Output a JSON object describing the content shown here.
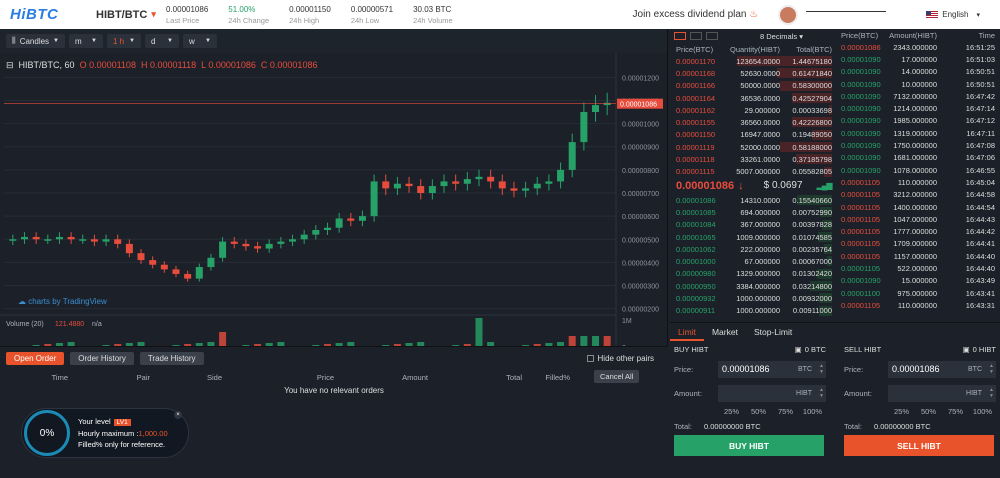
{
  "header": {
    "logo": "HiBTC",
    "pair": "HIBT/BTC",
    "stats": [
      {
        "value": "0.00001086",
        "label": "Last Price"
      },
      {
        "value": "51.00%",
        "label": "24h Change",
        "positive": true
      },
      {
        "value": "0.00001150",
        "label": "24h High"
      },
      {
        "value": "0.00000571",
        "label": "24h Low"
      },
      {
        "value": "30.03 BTC",
        "label": "24h Volume"
      }
    ],
    "promo": "Join excess dividend plan",
    "language": "English"
  },
  "chart_toolbar": {
    "candles": "Candles",
    "minute": "m",
    "hour": "1 h",
    "day": "d",
    "week": "w"
  },
  "chart_legend": {
    "symbol": "HIBT/BTC, 60",
    "o": "O 0.00001108",
    "h": "H 0.00001118",
    "l": "L 0.00001086",
    "c": "C 0.00001086"
  },
  "chart_data": {
    "type": "candlestick",
    "price_axis": [
      "0.00001200",
      "0.00001100",
      "0.00001000",
      "0.00000900",
      "0.00000800",
      "0.00000700",
      "0.00000600",
      "0.00000500",
      "0.00000400",
      "0.00000300",
      "0.00000200"
    ],
    "last_price_tag": "0.00001086",
    "x_ticks": [
      "Sep",
      "2",
      "3",
      "4",
      "5",
      "6",
      "10:00"
    ],
    "volume_label": "Volume (20)",
    "volume_value": "121.4880",
    "volume_na": "n/a",
    "volume_axis": "1M",
    "volume_zero": "0",
    "watermark": "charts by TradingView",
    "ylim": [
      1.9e-06,
      1.21e-05
    ],
    "closes": [
      5e-06,
      5.1e-06,
      5e-06,
      5e-06,
      5.1e-06,
      5e-06,
      5e-06,
      4.9e-06,
      5e-06,
      4.8e-06,
      4.4e-06,
      4.1e-06,
      3.9e-06,
      3.7e-06,
      3.5e-06,
      3.3e-06,
      3.8e-06,
      4.2e-06,
      4.9e-06,
      4.8e-06,
      4.7e-06,
      4.6e-06,
      4.8e-06,
      4.9e-06,
      5e-06,
      5.2e-06,
      5.4e-06,
      5.5e-06,
      5.9e-06,
      5.8e-06,
      6e-06,
      7.5e-06,
      7.2e-06,
      7.4e-06,
      7.3e-06,
      7e-06,
      7.3e-06,
      7.5e-06,
      7.4e-06,
      7.6e-06,
      7.7e-06,
      7.5e-06,
      7.2e-06,
      7.1e-06,
      7.2e-06,
      7.4e-06,
      7.5e-06,
      8e-06,
      9.2e-06,
      1.05e-05,
      1.08e-05,
      1.09e-05
    ]
  },
  "orders": {
    "tabs": [
      "Open Order",
      "Order History",
      "Trade History"
    ],
    "hide_other": "Hide other pairs",
    "columns": [
      "Time",
      "Pair",
      "Side",
      "Price",
      "Amount",
      "Total",
      "Filled%"
    ],
    "cancel_all": "Cancel All",
    "empty": "You have no relevant orders"
  },
  "level": {
    "percent": "0%",
    "your_level": "Your level",
    "badge": "LV1",
    "hourly_label": "Hourly maximum :",
    "hourly_value": "1,000.00",
    "note": "Filled% only for reference."
  },
  "orderbook": {
    "decimals": "8 Decimals",
    "headers": [
      "Price(BTC)",
      "Quantity(HIBT)",
      "Total(BTC)"
    ],
    "asks": [
      {
        "p": "0.00001170",
        "q": "123654.0000",
        "t": "1.44675180",
        "w": 0.95
      },
      {
        "p": "0.00001168",
        "q": "52630.0000",
        "t": "0.61471840",
        "w": 0.55
      },
      {
        "p": "0.00001166",
        "q": "50000.0000",
        "t": "0.58300000",
        "w": 0.52
      },
      {
        "p": "0.00001164",
        "q": "36536.0000",
        "t": "0.42527904",
        "w": 0.4
      },
      {
        "p": "0.00001162",
        "q": "29.000000",
        "t": "0.00033698",
        "w": 0.03
      },
      {
        "p": "0.00001155",
        "q": "36560.0000",
        "t": "0.42226800",
        "w": 0.4
      },
      {
        "p": "0.00001150",
        "q": "16947.0000",
        "t": "0.19489050",
        "w": 0.2
      },
      {
        "p": "0.00001119",
        "q": "52000.0000",
        "t": "0.58188000",
        "w": 0.52
      },
      {
        "p": "0.00001118",
        "q": "33261.0000",
        "t": "0.37185798",
        "w": 0.36
      },
      {
        "p": "0.00001115",
        "q": "5007.000000",
        "t": "0.05582805",
        "w": 0.08
      }
    ],
    "mid_price": "0.00001086",
    "mid_usd": "$ 0.0697",
    "bids": [
      {
        "p": "0.00001086",
        "q": "14310.0000",
        "t": "0.15540660",
        "w": 0.35
      },
      {
        "p": "0.00001085",
        "q": "694.000000",
        "t": "0.00752990",
        "w": 0.12
      },
      {
        "p": "0.00001084",
        "q": "367.000000",
        "t": "0.00397828",
        "w": 0.1
      },
      {
        "p": "0.00001065",
        "q": "1009.000000",
        "t": "0.01074585",
        "w": 0.14
      },
      {
        "p": "0.00001062",
        "q": "222.000000",
        "t": "0.00235764",
        "w": 0.08
      },
      {
        "p": "0.00001000",
        "q": "67.000000",
        "t": "0.00067000",
        "w": 0.05
      },
      {
        "p": "0.00000980",
        "q": "1329.000000",
        "t": "0.01302420",
        "w": 0.15
      },
      {
        "p": "0.00000950",
        "q": "3384.000000",
        "t": "0.03214800",
        "w": 0.22
      },
      {
        "p": "0.00000932",
        "q": "1000.000000",
        "t": "0.00932000",
        "w": 0.13
      },
      {
        "p": "0.00000911",
        "q": "1000.000000",
        "t": "0.00911000",
        "w": 0.13
      }
    ]
  },
  "trades": {
    "headers": [
      "Price(BTC)",
      "Amount(HIBT)",
      "Time"
    ],
    "rows": [
      {
        "p": "0.00001086",
        "a": "2343.000000",
        "t": "16:51:25",
        "s": "sell"
      },
      {
        "p": "0.00001090",
        "a": "17.000000",
        "t": "16:51:03",
        "s": "buy"
      },
      {
        "p": "0.00001090",
        "a": "14.000000",
        "t": "16:50:51",
        "s": "buy"
      },
      {
        "p": "0.00001090",
        "a": "10.000000",
        "t": "16:50:51",
        "s": "buy"
      },
      {
        "p": "0.00001090",
        "a": "7132.000000",
        "t": "16:47:42",
        "s": "buy"
      },
      {
        "p": "0.00001090",
        "a": "1214.000000",
        "t": "16:47:14",
        "s": "buy"
      },
      {
        "p": "0.00001090",
        "a": "1985.000000",
        "t": "16:47:12",
        "s": "buy"
      },
      {
        "p": "0.00001090",
        "a": "1319.000000",
        "t": "16:47:11",
        "s": "buy"
      },
      {
        "p": "0.00001090",
        "a": "1750.000000",
        "t": "16:47:08",
        "s": "buy"
      },
      {
        "p": "0.00001090",
        "a": "1681.000000",
        "t": "16:47:06",
        "s": "buy"
      },
      {
        "p": "0.00001090",
        "a": "1078.000000",
        "t": "16:46:55",
        "s": "buy"
      },
      {
        "p": "0.00001105",
        "a": "110.000000",
        "t": "16:45:04",
        "s": "sell"
      },
      {
        "p": "0.00001105",
        "a": "3212.000000",
        "t": "16:44:58",
        "s": "sell"
      },
      {
        "p": "0.00001105",
        "a": "1400.000000",
        "t": "16:44:54",
        "s": "sell"
      },
      {
        "p": "0.00001105",
        "a": "1047.000000",
        "t": "16:44:43",
        "s": "sell"
      },
      {
        "p": "0.00001105",
        "a": "1777.000000",
        "t": "16:44:42",
        "s": "sell"
      },
      {
        "p": "0.00001105",
        "a": "1709.000000",
        "t": "16:44:41",
        "s": "sell"
      },
      {
        "p": "0.00001105",
        "a": "1157.000000",
        "t": "16:44:40",
        "s": "sell"
      },
      {
        "p": "0.00001105",
        "a": "522.000000",
        "t": "16:44:40",
        "s": "buy"
      },
      {
        "p": "0.00001090",
        "a": "15.000000",
        "t": "16:43:49",
        "s": "buy"
      },
      {
        "p": "0.00001100",
        "a": "975.000000",
        "t": "16:43:41",
        "s": "buy"
      },
      {
        "p": "0.00001105",
        "a": "110.000000",
        "t": "16:43:31",
        "s": "sell"
      }
    ]
  },
  "trade_form": {
    "tabs": [
      "Limit",
      "Market",
      "Stop-Limit"
    ],
    "buy": {
      "title": "BUY HIBT",
      "balance": "0 BTC",
      "price": "0.00001086",
      "price_unit": "BTC",
      "amount_unit": "HIBT",
      "total": "0.00000000 BTC",
      "button": "BUY HIBT"
    },
    "sell": {
      "title": "SELL HIBT",
      "balance": "0 HIBT",
      "price": "0.00001086",
      "price_unit": "BTC",
      "amount_unit": "HIBT",
      "total": "0.00000000 BTC",
      "button": "SELL HIBT"
    },
    "price_label": "Price:",
    "amount_label": "Amount:",
    "total_label": "Total:",
    "percents": [
      "25%",
      "50%",
      "75%",
      "100%"
    ]
  },
  "colors": {
    "accent": "#e9532c",
    "up": "#26a269",
    "down": "#e74c3c",
    "bg": "#1c2129"
  }
}
